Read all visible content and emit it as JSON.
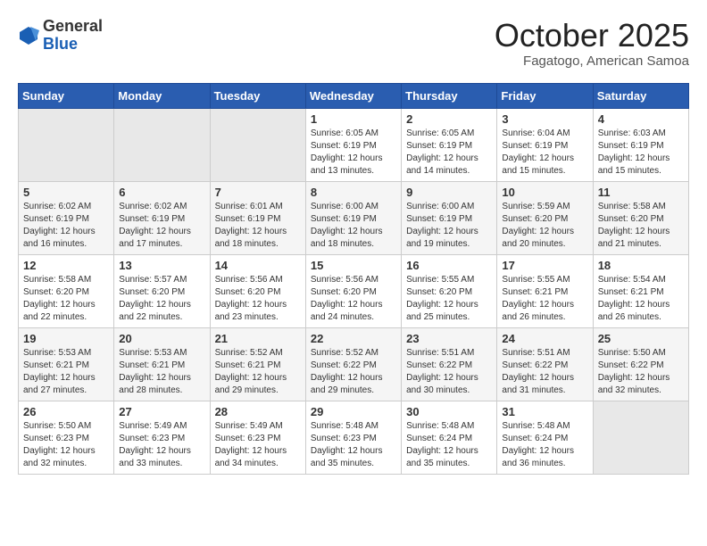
{
  "header": {
    "logo_general": "General",
    "logo_blue": "Blue",
    "month_title": "October 2025",
    "location": "Fagatogo, American Samoa"
  },
  "weekdays": [
    "Sunday",
    "Monday",
    "Tuesday",
    "Wednesday",
    "Thursday",
    "Friday",
    "Saturday"
  ],
  "weeks": [
    [
      {
        "day": "",
        "info": ""
      },
      {
        "day": "",
        "info": ""
      },
      {
        "day": "",
        "info": ""
      },
      {
        "day": "1",
        "info": "Sunrise: 6:05 AM\nSunset: 6:19 PM\nDaylight: 12 hours\nand 13 minutes."
      },
      {
        "day": "2",
        "info": "Sunrise: 6:05 AM\nSunset: 6:19 PM\nDaylight: 12 hours\nand 14 minutes."
      },
      {
        "day": "3",
        "info": "Sunrise: 6:04 AM\nSunset: 6:19 PM\nDaylight: 12 hours\nand 15 minutes."
      },
      {
        "day": "4",
        "info": "Sunrise: 6:03 AM\nSunset: 6:19 PM\nDaylight: 12 hours\nand 15 minutes."
      }
    ],
    [
      {
        "day": "5",
        "info": "Sunrise: 6:02 AM\nSunset: 6:19 PM\nDaylight: 12 hours\nand 16 minutes."
      },
      {
        "day": "6",
        "info": "Sunrise: 6:02 AM\nSunset: 6:19 PM\nDaylight: 12 hours\nand 17 minutes."
      },
      {
        "day": "7",
        "info": "Sunrise: 6:01 AM\nSunset: 6:19 PM\nDaylight: 12 hours\nand 18 minutes."
      },
      {
        "day": "8",
        "info": "Sunrise: 6:00 AM\nSunset: 6:19 PM\nDaylight: 12 hours\nand 18 minutes."
      },
      {
        "day": "9",
        "info": "Sunrise: 6:00 AM\nSunset: 6:19 PM\nDaylight: 12 hours\nand 19 minutes."
      },
      {
        "day": "10",
        "info": "Sunrise: 5:59 AM\nSunset: 6:20 PM\nDaylight: 12 hours\nand 20 minutes."
      },
      {
        "day": "11",
        "info": "Sunrise: 5:58 AM\nSunset: 6:20 PM\nDaylight: 12 hours\nand 21 minutes."
      }
    ],
    [
      {
        "day": "12",
        "info": "Sunrise: 5:58 AM\nSunset: 6:20 PM\nDaylight: 12 hours\nand 22 minutes."
      },
      {
        "day": "13",
        "info": "Sunrise: 5:57 AM\nSunset: 6:20 PM\nDaylight: 12 hours\nand 22 minutes."
      },
      {
        "day": "14",
        "info": "Sunrise: 5:56 AM\nSunset: 6:20 PM\nDaylight: 12 hours\nand 23 minutes."
      },
      {
        "day": "15",
        "info": "Sunrise: 5:56 AM\nSunset: 6:20 PM\nDaylight: 12 hours\nand 24 minutes."
      },
      {
        "day": "16",
        "info": "Sunrise: 5:55 AM\nSunset: 6:20 PM\nDaylight: 12 hours\nand 25 minutes."
      },
      {
        "day": "17",
        "info": "Sunrise: 5:55 AM\nSunset: 6:21 PM\nDaylight: 12 hours\nand 26 minutes."
      },
      {
        "day": "18",
        "info": "Sunrise: 5:54 AM\nSunset: 6:21 PM\nDaylight: 12 hours\nand 26 minutes."
      }
    ],
    [
      {
        "day": "19",
        "info": "Sunrise: 5:53 AM\nSunset: 6:21 PM\nDaylight: 12 hours\nand 27 minutes."
      },
      {
        "day": "20",
        "info": "Sunrise: 5:53 AM\nSunset: 6:21 PM\nDaylight: 12 hours\nand 28 minutes."
      },
      {
        "day": "21",
        "info": "Sunrise: 5:52 AM\nSunset: 6:21 PM\nDaylight: 12 hours\nand 29 minutes."
      },
      {
        "day": "22",
        "info": "Sunrise: 5:52 AM\nSunset: 6:22 PM\nDaylight: 12 hours\nand 29 minutes."
      },
      {
        "day": "23",
        "info": "Sunrise: 5:51 AM\nSunset: 6:22 PM\nDaylight: 12 hours\nand 30 minutes."
      },
      {
        "day": "24",
        "info": "Sunrise: 5:51 AM\nSunset: 6:22 PM\nDaylight: 12 hours\nand 31 minutes."
      },
      {
        "day": "25",
        "info": "Sunrise: 5:50 AM\nSunset: 6:22 PM\nDaylight: 12 hours\nand 32 minutes."
      }
    ],
    [
      {
        "day": "26",
        "info": "Sunrise: 5:50 AM\nSunset: 6:23 PM\nDaylight: 12 hours\nand 32 minutes."
      },
      {
        "day": "27",
        "info": "Sunrise: 5:49 AM\nSunset: 6:23 PM\nDaylight: 12 hours\nand 33 minutes."
      },
      {
        "day": "28",
        "info": "Sunrise: 5:49 AM\nSunset: 6:23 PM\nDaylight: 12 hours\nand 34 minutes."
      },
      {
        "day": "29",
        "info": "Sunrise: 5:48 AM\nSunset: 6:23 PM\nDaylight: 12 hours\nand 35 minutes."
      },
      {
        "day": "30",
        "info": "Sunrise: 5:48 AM\nSunset: 6:24 PM\nDaylight: 12 hours\nand 35 minutes."
      },
      {
        "day": "31",
        "info": "Sunrise: 5:48 AM\nSunset: 6:24 PM\nDaylight: 12 hours\nand 36 minutes."
      },
      {
        "day": "",
        "info": ""
      }
    ]
  ]
}
